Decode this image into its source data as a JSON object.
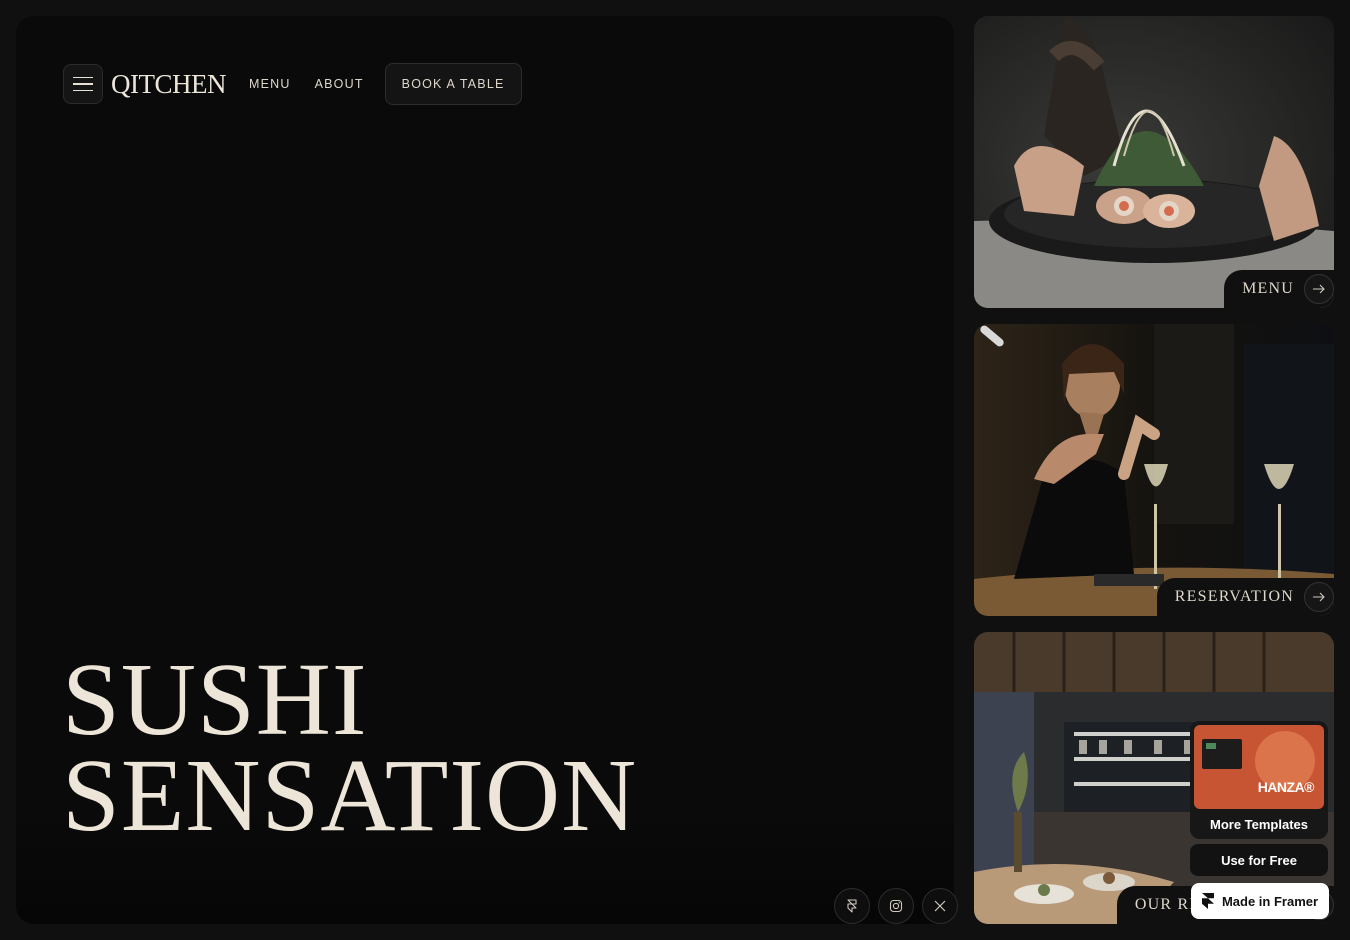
{
  "nav": {
    "logo": "QITCHEN",
    "menu_label": "MENU",
    "about_label": "ABOUT",
    "book_label": "BOOK A TABLE"
  },
  "hero": {
    "headline_line1": "SUSHI",
    "headline_line2": "SENSATION"
  },
  "socials": [
    {
      "icon": "framer-icon"
    },
    {
      "icon": "instagram-icon"
    },
    {
      "icon": "x-icon"
    }
  ],
  "cards": [
    {
      "label": "MENU"
    },
    {
      "label": "RESERVATION"
    },
    {
      "label": "OUR RESTAURANT"
    }
  ],
  "promo": {
    "brand": "HANZA®",
    "more_templates": "More Templates",
    "use_free": "Use for Free",
    "made_in_framer": "Made in Framer"
  },
  "colors": {
    "background": "#101010",
    "panel": "#0a0a0a",
    "text": "#ede6d8"
  }
}
